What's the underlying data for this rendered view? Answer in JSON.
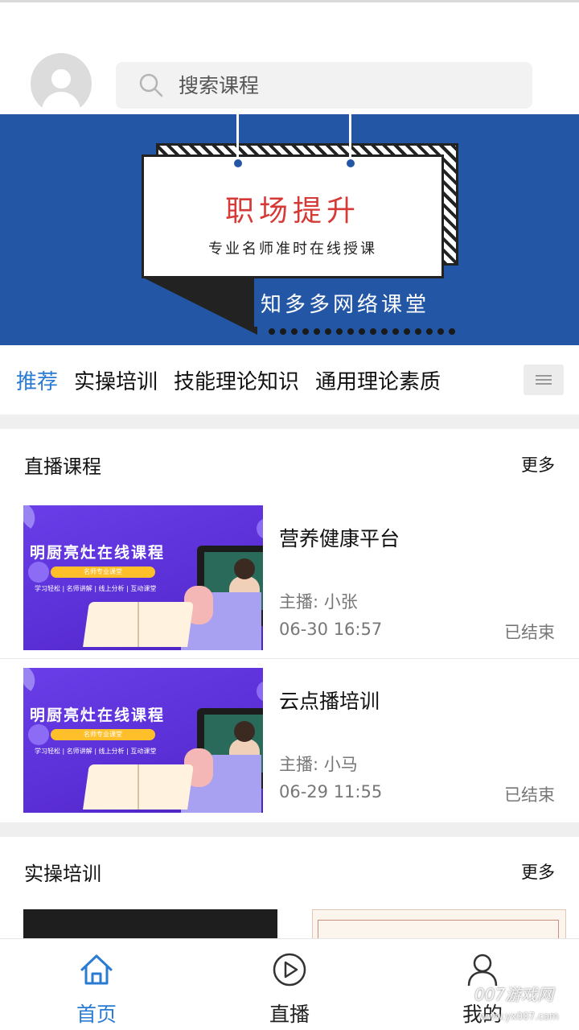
{
  "search": {
    "placeholder": "搜索课程"
  },
  "banner": {
    "headline": "职场提升",
    "subline": "专业名师准时在线授课",
    "brand": "知多多网络课堂"
  },
  "tabs": [
    {
      "label": "推荐",
      "active": true
    },
    {
      "label": "实操培训",
      "active": false
    },
    {
      "label": "技能理论知识",
      "active": false
    },
    {
      "label": "通用理论素质",
      "active": false
    }
  ],
  "live_section": {
    "title": "直播课程",
    "more": "更多",
    "courses": [
      {
        "name": "营养健康平台",
        "host_label": "主播:",
        "host": "小张",
        "time": "06-30 16:57",
        "status": "已结束",
        "thumb_title": "明厨亮灶在线课程",
        "thumb_pill": "名师专业课堂",
        "thumb_sub": "学习轻松 | 名师讲解 | 线上分析 | 互动课堂"
      },
      {
        "name": "云点播培训",
        "host_label": "主播:",
        "host": "小马",
        "time": "06-29 11:55",
        "status": "已结束",
        "thumb_title": "明厨亮灶在线课程",
        "thumb_pill": "名师专业课堂",
        "thumb_sub": "学习轻松 | 名师讲解 | 线上分析 | 互动课堂"
      }
    ]
  },
  "practice_section": {
    "title": "实操培训",
    "more": "更多"
  },
  "bottom_nav": [
    {
      "label": "首页",
      "icon": "home-icon",
      "active": true
    },
    {
      "label": "直播",
      "icon": "play-circle-icon",
      "active": false
    },
    {
      "label": "我的",
      "icon": "user-icon",
      "active": false
    }
  ],
  "watermark": {
    "text": "007游戏网",
    "url": "www.yx007.com"
  },
  "colors": {
    "accent": "#2a7bd3",
    "banner_bg": "#2357a6",
    "headline_red": "#d63a36"
  }
}
